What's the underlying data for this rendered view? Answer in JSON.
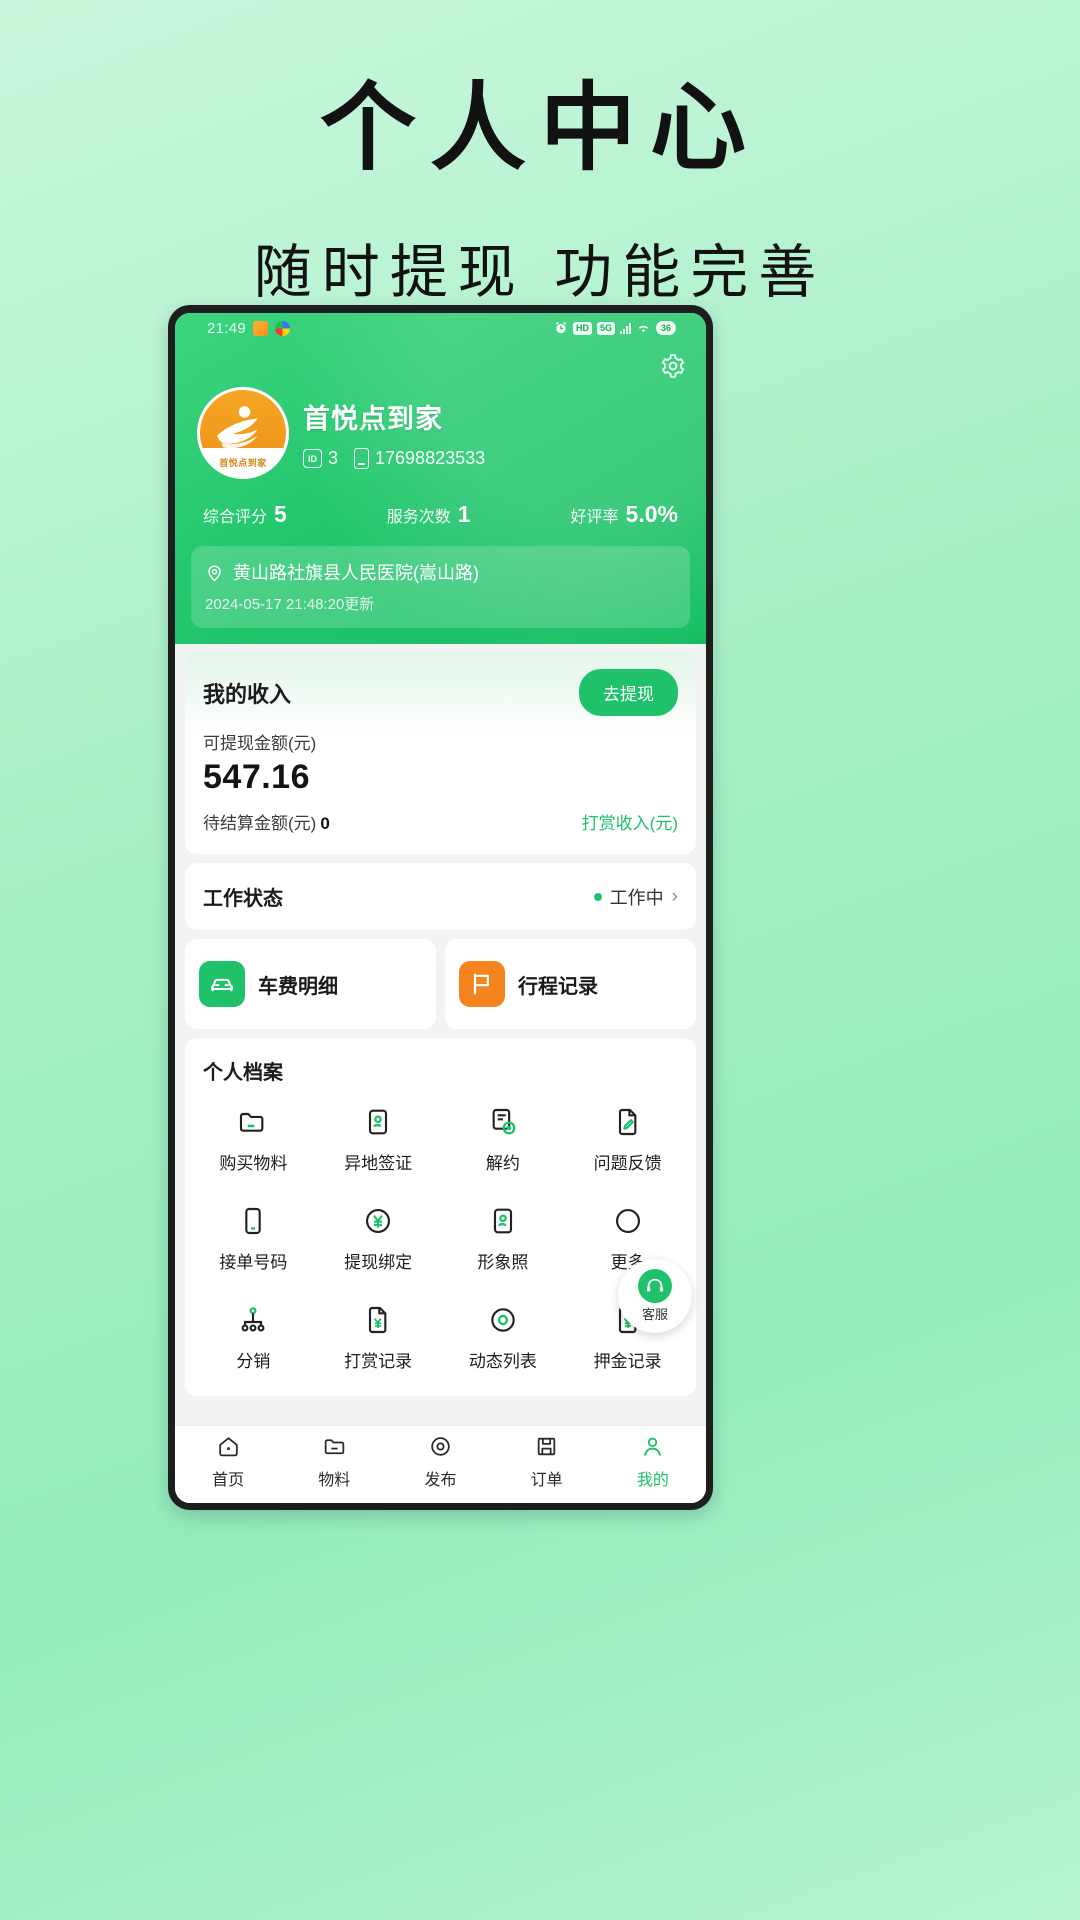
{
  "promo": {
    "title": "个人中心",
    "subtitle": "随时提现 功能完善"
  },
  "statusbar": {
    "time": "21:49",
    "hd_label": "HD",
    "network_label": "5G",
    "battery": "36"
  },
  "header": {
    "gear_icon": "gear-icon",
    "avatar_caption": "首悦点到家",
    "name": "首悦点到家",
    "id_badge": "ID",
    "id_value": "3",
    "phone": "17698823533",
    "stats": [
      {
        "label": "综合评分",
        "value": "5"
      },
      {
        "label": "服务次数",
        "value": "1"
      },
      {
        "label": "好评率",
        "value": "5.0%"
      }
    ],
    "location": {
      "name": "黄山路社旗县人民医院(嵩山路)",
      "updated": "2024-05-17 21:48:20更新"
    }
  },
  "income": {
    "title": "我的收入",
    "withdraw_button": "去提现",
    "available_label": "可提现金额(元)",
    "available_amount": "547.16",
    "pending_label": "待结算金额(元)",
    "pending_amount": "0",
    "tip_link": "打赏收入(元)"
  },
  "work_status": {
    "label": "工作状态",
    "value": "工作中",
    "dot_color": "#1fc26a"
  },
  "feature_cards": [
    {
      "label": "车费明细",
      "icon": "car-icon",
      "color": "#1fc26a"
    },
    {
      "label": "行程记录",
      "icon": "flag-icon",
      "color": "#f5841f"
    }
  ],
  "archive": {
    "title": "个人档案",
    "items": [
      {
        "label": "购买物料",
        "icon": "folder-icon"
      },
      {
        "label": "异地签证",
        "icon": "id-card-icon"
      },
      {
        "label": "解约",
        "icon": "contract-cancel-icon"
      },
      {
        "label": "问题反馈",
        "icon": "feedback-edit-icon"
      },
      {
        "label": "接单号码",
        "icon": "mobile-phone-icon"
      },
      {
        "label": "提现绑定",
        "icon": "yuan-circle-icon"
      },
      {
        "label": "形象照",
        "icon": "portrait-icon"
      },
      {
        "label": "更多",
        "icon": "more-icon"
      },
      {
        "label": "分销",
        "icon": "distribution-tree-icon"
      },
      {
        "label": "打赏记录",
        "icon": "reward-record-icon"
      },
      {
        "label": "动态列表",
        "icon": "target-circle-icon"
      },
      {
        "label": "押金记录",
        "icon": "deposit-record-icon"
      }
    ]
  },
  "fab": {
    "label": "客服",
    "icon": "headset-icon"
  },
  "tabbar": {
    "items": [
      {
        "label": "首页",
        "icon": "home-icon",
        "active": false
      },
      {
        "label": "物料",
        "icon": "materials-icon",
        "active": false
      },
      {
        "label": "发布",
        "icon": "publish-icon",
        "active": false
      },
      {
        "label": "订单",
        "icon": "orders-icon",
        "active": false
      },
      {
        "label": "我的",
        "icon": "profile-icon",
        "active": true
      }
    ]
  }
}
